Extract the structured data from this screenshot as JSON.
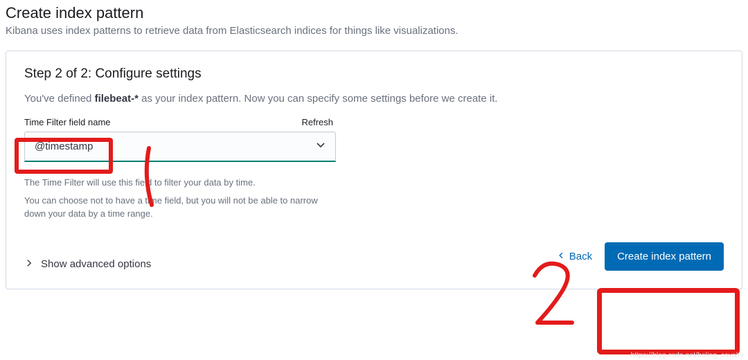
{
  "page": {
    "title": "Create index pattern",
    "description": "Kibana uses index patterns to retrieve data from Elasticsearch indices for things like visualizations."
  },
  "step": {
    "heading": "Step 2 of 2: Configure settings",
    "defined_prefix": "You've defined ",
    "defined_pattern": "filebeat-*",
    "defined_suffix": " as your index pattern. Now you can specify some settings before we create it."
  },
  "time_filter": {
    "label": "Time Filter field name",
    "refresh_label": "Refresh",
    "selected": "@timestamp",
    "help1": "The Time Filter will use this field to filter your data by time.",
    "help2": "You can choose not to have a time field, but you will not be able to narrow down your data by a time range."
  },
  "advanced": {
    "label": "Show advanced options"
  },
  "footer": {
    "back": "Back",
    "create": "Create index pattern"
  },
  "watermark": "https://blog.csdn.net/boling_cavalry"
}
